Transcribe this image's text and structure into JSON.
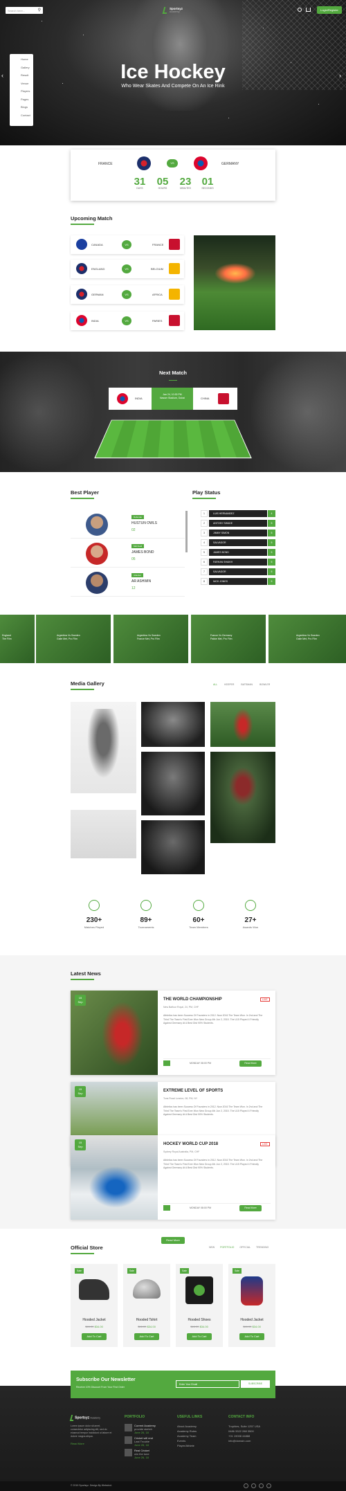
{
  "header": {
    "search_placeholder": "Search here...",
    "brand": "Sportsyz",
    "brand_sub": "Academy",
    "login_label": "Login/Register",
    "cart_count": "0"
  },
  "nav": [
    "Home",
    "Gallery",
    "Result",
    "Venue",
    "Players",
    "Pages",
    "Blogs",
    "Contact"
  ],
  "hero": {
    "title": "Ice Hockey",
    "subtitle": "Who Wear Skates And Compete On An Ice Rink"
  },
  "countdown": {
    "team1": "FRANCE",
    "team2": "GERMANY",
    "vs": "VS",
    "units": [
      {
        "value": "31",
        "label": "DAYS"
      },
      {
        "value": "05",
        "label": "HOURS"
      },
      {
        "value": "23",
        "label": "MINUTES"
      },
      {
        "value": "01",
        "label": "SECONDS"
      }
    ]
  },
  "upcoming": {
    "title": "Upcoming Match",
    "matches": [
      {
        "left": "CANADA",
        "right": "FRANCE"
      },
      {
        "left": "ENGLAND",
        "right": "BELGIUM"
      },
      {
        "left": "GERMAN",
        "right": "AFRICA"
      },
      {
        "left": "INDIA",
        "right": "PARIES"
      }
    ],
    "vs": "VS"
  },
  "next_match": {
    "title": "Next Match",
    "team1": "INDIA",
    "team2": "CHINA",
    "date": "Jan 24, 10:30 PM",
    "venue": "Nasser Stadium, Dubai"
  },
  "best_player": {
    "title": "Best Player",
    "players": [
      {
        "role": "Defender",
        "name": "HUSTUN OWLS",
        "score": "02"
      },
      {
        "role": "Mid Field",
        "name": "JAMES BOND",
        "score": "05"
      },
      {
        "role": "Attacker",
        "name": "AR ASHWIN",
        "score": "12"
      }
    ]
  },
  "play_status": {
    "title": "Play Status",
    "rows": [
      {
        "num": "1",
        "name": "LUIS HERNANDEZ",
        "score": "4"
      },
      {
        "num": "2",
        "name": "ANTONY SWADE",
        "score": "5"
      },
      {
        "num": "3",
        "name": "JIMMY SIMON",
        "score": "5"
      },
      {
        "num": "4",
        "name": "SALVADOR",
        "score": "5"
      },
      {
        "num": "5",
        "name": "JAMES BOND",
        "score": "5"
      },
      {
        "num": "6",
        "name": "FARHAN SHAIKH",
        "score": "5"
      },
      {
        "num": "7",
        "name": "SALVADOR",
        "score": "5"
      },
      {
        "num": "8",
        "name": "NICK JONES",
        "score": "5"
      }
    ]
  },
  "strip": [
    {
      "line1": "England",
      "line2": "The Film"
    },
    {
      "line1": "Argentina Vs Sweden",
      "line2": "Galle Met, Pro Film"
    },
    {
      "line1": "Argentina Vs Sweden",
      "line2": "France Met, Pro Film"
    },
    {
      "line1": "France Vs Germany",
      "line2": "Pakke Met, Pro Film"
    },
    {
      "line1": "Argentina Vs Sweden",
      "line2": "Galle Met, Pro Film"
    }
  ],
  "gallery": {
    "title": "Media Gallery",
    "filters": [
      "ALL",
      "KEEPER",
      "BATSMAN",
      "BOWLER"
    ]
  },
  "counters": [
    {
      "value": "230+",
      "label": "Matches Played"
    },
    {
      "value": "89+",
      "label": "Tournaments"
    },
    {
      "value": "60+",
      "label": "Team Members"
    },
    {
      "value": "27+",
      "label": "Awards Won"
    }
  ],
  "news": {
    "title": "Latest News",
    "date_day": "15",
    "date_mon": "Sep",
    "more": "Read More",
    "items": [
      {
        "title": "THE WORLD CHAMPIONSHIP",
        "meta": "New Balfour Royal, 24, PM, CHF",
        "badge": "LIVE",
        "date": "MONDAY 08:00 PM",
        "btn": "Read More",
        "text": "Athletics has been Success Of Founders in 2012. Now 2016 The Team Won. In 2nd and The Third The Team's First Ever Won New Group 4th Jun 2, 2015. The U15 Played 4 Friendly Against Germany At A Best Dist 90% Students."
      },
      {
        "title": "EXTREME LEVEL OF SPORTS",
        "meta": "Tons Road London, 08, PM, NY",
        "badge": "",
        "date": "MONDAY 08:00 PM",
        "btn": "Read More",
        "text": "Athletics has been Success Of Founders in 2012. Now 2016 The Team Won. In 2nd and The Third The Team's First Ever Won New Group 4th Jun 2, 2015. The U15 Played 4 Friendly Against Germany At A Best Dist 90% Students."
      },
      {
        "title": "HOCKEY WORLD CUP 2018",
        "meta": "Sydney Royal Australia, PM, CHF",
        "badge": "LIVE",
        "date": "MONDAY 08:00 PM",
        "btn": "Read More",
        "text": "Athletics has been Success Of Founders in 2012. Now 2016 The Team Won. In 2nd and The Third The Team's First Ever Won New Group 4th Jun 2, 2015. The U15 Played 4 Friendly Against Germany At A Best Dist 90% Students."
      }
    ],
    "load_more": "Read More"
  },
  "store": {
    "title": "Official Store",
    "filters": [
      "NEW",
      "PORTFOLIO",
      "OFFICIAL",
      "TRENDING"
    ],
    "products": [
      {
        "tag": "Sale",
        "name": "Hooded Jacket",
        "old": "$46.00",
        "price": "$34.00",
        "btn": "Add To Cart"
      },
      {
        "tag": "Sale",
        "name": "Hooded Tshirt",
        "old": "$46.00",
        "price": "$34.00",
        "btn": "Add To Cart"
      },
      {
        "tag": "Sale",
        "name": "Hooded Shoes",
        "old": "$46.00",
        "price": "$34.00",
        "btn": "Add To Cart"
      },
      {
        "tag": "Sale",
        "name": "Hooded Jacket",
        "old": "$46.00",
        "price": "$34.00",
        "btn": "Add To Cart"
      }
    ]
  },
  "newsletter": {
    "title": "Subscribe Our Newsletter",
    "sub": "Receive 10% Discount From Your First Order",
    "placeholder": "Enter Your Email",
    "btn": "SUBSCRIBE"
  },
  "footer": {
    "brand": "Sportsyz",
    "brand_sub": "Academy",
    "about": "Lorem ipsum dolor sit amet, consectetur adipiscing elit, sed do eiusmod tempor incididunt ut labore et dolore magna aliqua.",
    "read_more": "Read More",
    "portfolio_title": "PORTFOLIO",
    "portfolio": [
      {
        "title": "Current Academy",
        "sub": "provide sketch",
        "date": "June 26, 18"
      },
      {
        "title": "Cricket will end",
        "sub": "Last Trouble",
        "date": "June 26, 18"
      },
      {
        "title": "Real Cricket",
        "sub": "win the tune",
        "date": "June 26, 18"
      }
    ],
    "links_title": "USEFUL LINKS",
    "links": [
      "About Academy",
      "Academy Rules",
      "Academy Team",
      "Events",
      "Player/Athlete"
    ],
    "contact_title": "CONTACT INFO",
    "contact": [
      "Trophies, Suite 1257 USA",
      "0486 3322 288 3500",
      "+01 19008 44888",
      "info@domain.com"
    ],
    "copyright": "© 2019 Sportsyz. Design By Webstrot."
  },
  "colors": {
    "accent": "#53a93f",
    "dark": "#1f1f1f"
  }
}
